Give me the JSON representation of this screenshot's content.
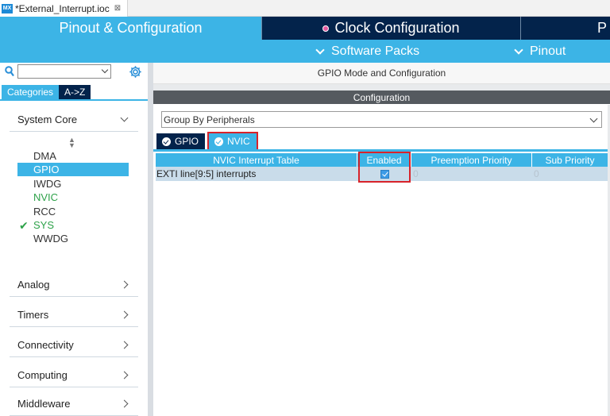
{
  "file_tab": {
    "icon": "MX",
    "label": "*External_Interrupt.ioc",
    "close": "⊠"
  },
  "main_nav": {
    "pinout": "Pinout & Configuration",
    "clock": "Clock Configuration",
    "project": "P"
  },
  "sub_nav": {
    "software_packs": "Software Packs",
    "pinout": "Pinout"
  },
  "left_panel": {
    "search": {
      "value": ""
    },
    "tabs": [
      "Categories",
      "A->Z"
    ],
    "system_core": {
      "title": "System Core",
      "items": [
        {
          "label": "DMA",
          "state": "normal"
        },
        {
          "label": "GPIO",
          "state": "selected"
        },
        {
          "label": "IWDG",
          "state": "normal"
        },
        {
          "label": "NVIC",
          "state": "green"
        },
        {
          "label": "RCC",
          "state": "normal"
        },
        {
          "label": "SYS",
          "state": "checked"
        },
        {
          "label": "WWDG",
          "state": "normal"
        }
      ]
    },
    "sections": [
      "Analog",
      "Timers",
      "Connectivity",
      "Computing",
      "Middleware"
    ]
  },
  "right_panel": {
    "title": "GPIO Mode and Configuration",
    "config_label": "Configuration",
    "group_select": "Group By Peripherals",
    "tabs": [
      "GPIO",
      "NVIC"
    ],
    "table": {
      "headers": [
        "NVIC Interrupt Table",
        "Enabled",
        "Preemption Priority",
        "Sub Priority"
      ],
      "rows": [
        {
          "name": "EXTI line[9:5] interrupts",
          "enabled": true,
          "preemption": "0",
          "sub": "0"
        }
      ]
    }
  }
}
